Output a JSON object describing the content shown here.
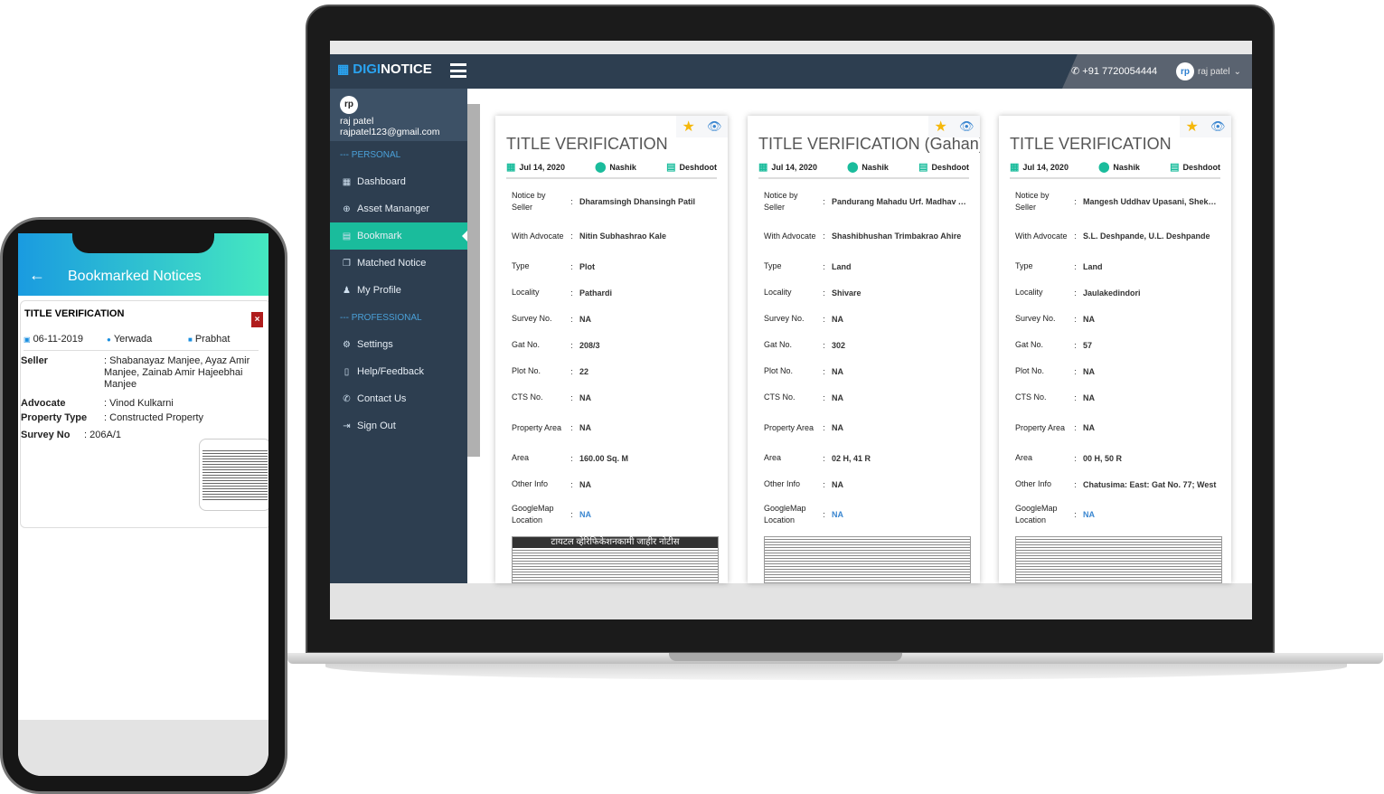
{
  "colors": {
    "header": "#2d3e50",
    "accent": "#1abc9c",
    "link": "#3a86d0",
    "star": "#f5b80c"
  },
  "laptop": {
    "logo": {
      "part1": "DIGI",
      "part2": "NOTICE"
    },
    "header": {
      "phone": "+91 7720054444",
      "avatar": "rp",
      "user": "raj patel"
    },
    "profile": {
      "avatar": "rp",
      "name": "raj patel",
      "email": "rajpatel123@gmail.com"
    },
    "sidebar": {
      "personal": "--- PERSONAL",
      "personal_items": [
        {
          "label": "Dashboard",
          "icon": "dashboard-icon"
        },
        {
          "label": "Asset Mananger",
          "icon": "plus-circle-icon"
        },
        {
          "label": "Bookmark",
          "icon": "bookmark-icon",
          "active": true
        },
        {
          "label": "Matched Notice",
          "icon": "copy-icon"
        },
        {
          "label": "My Profile",
          "icon": "user-icon"
        }
      ],
      "professional": "--- PROFESSIONAL",
      "professional_items": [
        {
          "label": "Settings",
          "icon": "gear-icon"
        },
        {
          "label": "Help/Feedback",
          "icon": "document-icon"
        },
        {
          "label": "Contact Us",
          "icon": "phone-icon"
        },
        {
          "label": "Sign Out",
          "icon": "sign-out-icon"
        }
      ]
    },
    "field_labels": [
      "Notice by Seller",
      "With Advocate",
      "Type",
      "Locality",
      "Survey No.",
      "Gat No.",
      "Plot No.",
      "CTS No.",
      "Property Area",
      "Area",
      "Other Info",
      "GoogleMap Location"
    ],
    "cards": [
      {
        "title": "TITLE VERIFICATION",
        "date": "Jul 14, 2020",
        "city": "Nashik",
        "paper": "Deshdoot",
        "values": [
          "Dharamsingh Dhansingh Patil",
          "Nitin Subhashrao Kale",
          "Plot",
          "Pathardi",
          "NA",
          "208/3",
          "22",
          "NA",
          "NA",
          "160.00 Sq. M",
          "NA",
          "NA"
        ],
        "clipping_heading": "टायटल व्हेरिफिकेशनकामी जाहीर नोटीस"
      },
      {
        "title": "TITLE VERIFICATION (Gahan)",
        "date": "Jul 14, 2020",
        "city": "Nashik",
        "paper": "Deshdoot",
        "values": [
          "Pandurang Mahadu Urf. Madhav Aher",
          "Shashibhushan Trimbakrao Ahire",
          "Land",
          "Shivare",
          "NA",
          "302",
          "NA",
          "NA",
          "NA",
          "02 H, 41 R",
          "NA",
          "NA"
        ]
      },
      {
        "title": "TITLE VERIFICATION",
        "date": "Jul 14, 2020",
        "city": "Nashik",
        "paper": "Deshdoot",
        "values": [
          "Mangesh Uddhav Upasani, Shekhar",
          "S.L. Deshpande, U.L. Deshpande",
          "Land",
          "Jaulakedindori",
          "NA",
          "57",
          "NA",
          "NA",
          "NA",
          "00 H, 50 R",
          "Chatusima: East: Gat No. 77; West",
          "NA"
        ]
      }
    ]
  },
  "phone": {
    "title": "Bookmarked Notices",
    "card": {
      "title": "TITLE VERIFICATION",
      "date": "06-11-2019",
      "location": "Yerwada",
      "paper": "Prabhat",
      "fields": [
        {
          "label": "Seller",
          "value": "Shabanayaz Manjee, Ayaz Amir Manjee, Zainab Amir Hajeebhai Manjee"
        },
        {
          "label": "Advocate",
          "value": "Vinod Kulkarni"
        },
        {
          "label": "Property Type",
          "value": "Constructed Property"
        },
        {
          "label": "Survey No",
          "value": "206A/1"
        }
      ]
    }
  }
}
